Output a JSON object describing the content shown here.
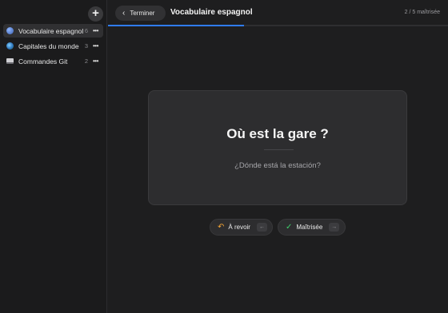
{
  "sidebar": {
    "add_label": "+",
    "decks": [
      {
        "name": "Vocabulaire espagnol",
        "count": "6",
        "icon": "bird-icon",
        "active": true
      },
      {
        "name": "Capitales du monde",
        "count": "3",
        "icon": "globe-icon",
        "active": false
      },
      {
        "name": "Commandes Git",
        "count": "2",
        "icon": "laptop-icon",
        "active": false
      }
    ],
    "more_label": "•••"
  },
  "header": {
    "back_label": "Terminer",
    "title": "Vocabulaire espagnol",
    "progress_text": "2 / 5 maîtrisée",
    "progress_fraction": 0.4,
    "accent": "#2f7cf6"
  },
  "card": {
    "question": "Où est la gare ?",
    "answer": "¿Dónde está la estación?"
  },
  "actions": {
    "review_label": "À revoir",
    "review_key": "←",
    "review_color": "#f0a336",
    "mastered_label": "Maîtrisée",
    "mastered_key": "→",
    "mastered_color": "#3fcf6c"
  }
}
